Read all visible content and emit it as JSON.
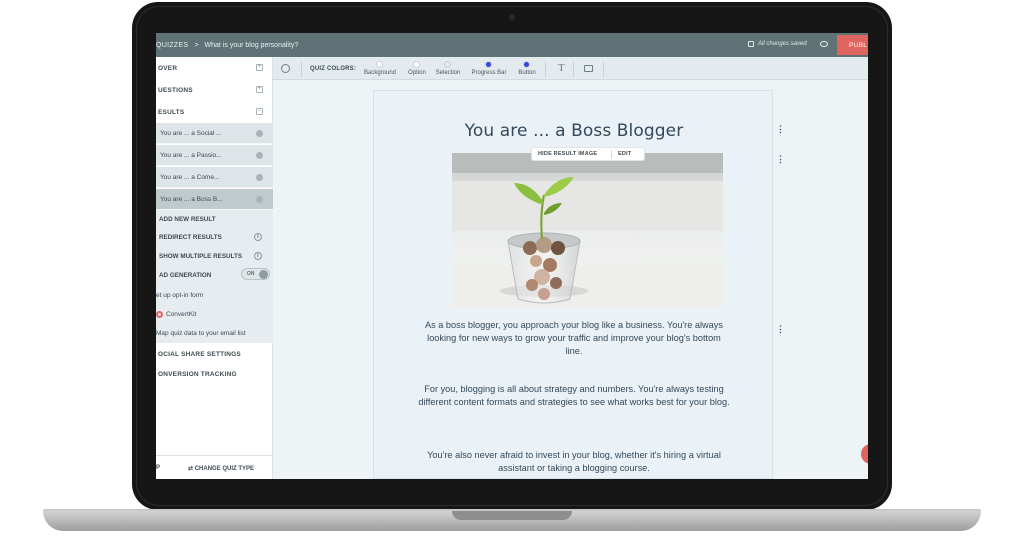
{
  "topbar": {
    "breadcrumb_section": "QUIZZES",
    "breadcrumb_separator": ">",
    "quiz_title": "What is your blog personality?",
    "save_status": "All changes saved",
    "publish_label": "PUBL"
  },
  "sidebar": {
    "cover_label": "OVER",
    "questions_label": "UESTIONS",
    "results_label": "ESULTS",
    "results": [
      "You are ... a Social ...",
      "You are ... a Passio...",
      "You are ... a Come...",
      "You are ... a Boss B..."
    ],
    "add_new_result": "ADD NEW RESULT",
    "redirect_results": "REDIRECT RESULTS",
    "show_multiple_results": "SHOW MULTIPLE RESULTS",
    "lead_generation": "AD GENERATION",
    "lead_toggle": "ON",
    "optin_form": "et up opt-in form",
    "convertkit": "ConvertKit",
    "map_quiz_data": "Map quiz data to your email list",
    "social_share": "OCIAL SHARE SETTINGS",
    "conversion_tracking": "ONVERSION TRACKING",
    "footer_left": "P",
    "footer_change_type": "⇄ CHANGE QUIZ TYPE"
  },
  "toolbar": {
    "quiz_colors_label": "QUIZ COLORS:",
    "swatches": [
      {
        "label": "Background",
        "color": "#ffffff"
      },
      {
        "label": "Option",
        "color": "#ffffff"
      },
      {
        "label": "Selection",
        "color": "#e3e9ec"
      },
      {
        "label": "Progress Bar",
        "color": "#3047e0"
      },
      {
        "label": "Button",
        "color": "#3047e0"
      }
    ]
  },
  "result": {
    "title": "You are ... a Boss Blogger",
    "hide_image_label": "HIDE RESULT IMAGE",
    "edit_label": "EDIT",
    "paragraphs": [
      "As a boss blogger, you approach your blog like a business. You're always looking for new ways to grow your traffic and improve your blog's bottom line.",
      "For you, blogging is all about strategy and numbers. You're always testing different content formats and strategies to see what works best for your blog.",
      "You're also never afraid to invest in your blog, whether it's hiring a virtual assistant or taking a blogging course."
    ]
  },
  "colors": {
    "topbar": "#5f7377",
    "publish": "#e0645f",
    "accent_blue": "#3047e0"
  }
}
